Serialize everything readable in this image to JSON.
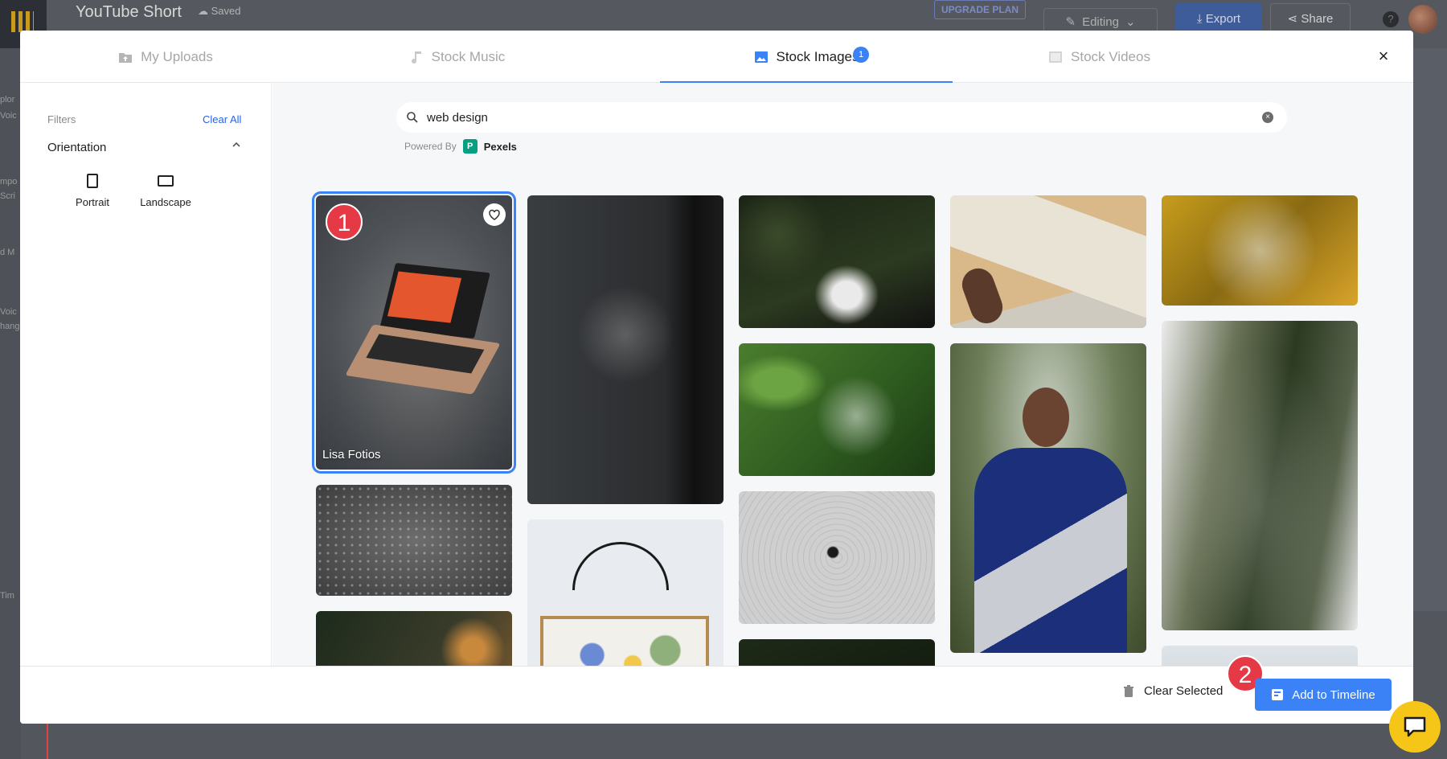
{
  "app": {
    "title": "YouTube Short",
    "saved_status": "Saved",
    "upgrade_label": "UPGRADE PLAN",
    "editing_label": "Editing",
    "export_label": "Export",
    "share_label": "Share",
    "help_label": "?"
  },
  "bg_sidebar": [
    "plor",
    "Voic",
    "mpo",
    "Scri",
    "d M",
    "Voic",
    "hang",
    "Tim"
  ],
  "modal": {
    "tabs": [
      {
        "label": "My Uploads",
        "icon": "upload-folder-icon"
      },
      {
        "label": "Stock Music",
        "icon": "music-note-icon"
      },
      {
        "label": "Stock Images",
        "icon": "image-icon",
        "badge": "1"
      },
      {
        "label": "Stock Videos",
        "icon": "video-icon"
      }
    ],
    "active_tab": "Stock Images",
    "close_label": "×"
  },
  "filters": {
    "label": "Filters",
    "clear_all": "Clear All",
    "orientation_label": "Orientation",
    "options": [
      {
        "label": "Portrait"
      },
      {
        "label": "Landscape"
      }
    ]
  },
  "search": {
    "value": "web design",
    "clear_label": "×",
    "powered_by": "Powered By",
    "provider_logo": "P",
    "provider": "Pexels"
  },
  "results": {
    "selected_credit": "Lisa Fotios",
    "step_markers": [
      "1",
      "2"
    ]
  },
  "footer": {
    "clear_selected": "Clear Selected",
    "add_to_timeline": "Add to Timeline"
  },
  "colors": {
    "accent": "#3b82f6",
    "marker": "#e63946",
    "pexels": "#05a081",
    "chat": "#f5c518"
  }
}
